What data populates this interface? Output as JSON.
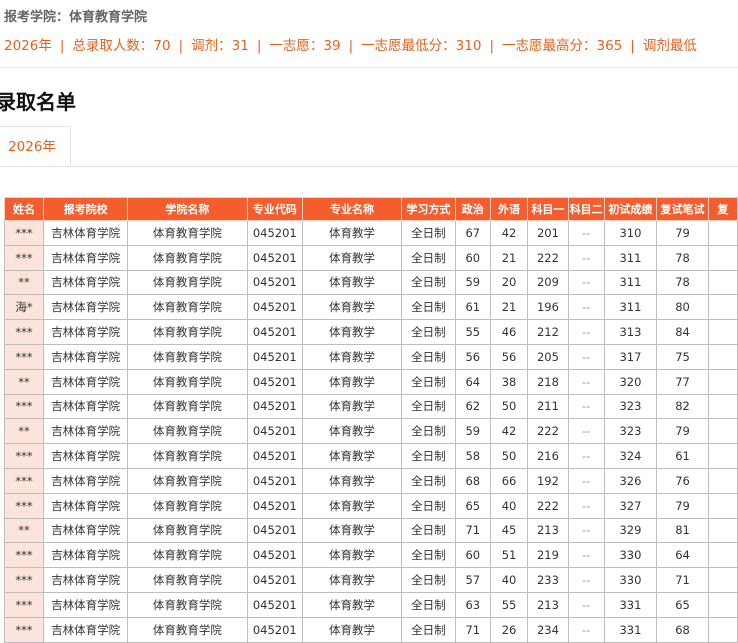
{
  "header": {
    "college_label": "报考学院：体育教育学院"
  },
  "stats": [
    "2026年",
    "总录取人数：70",
    "调剂：31",
    "一志愿：39",
    "一志愿最低分：310",
    "一志愿最高分：365",
    "调剂最低"
  ],
  "section_title": "录取名单",
  "tabs": [
    {
      "label": "2026年",
      "active": true
    }
  ],
  "table": {
    "columns": [
      "姓名",
      "报考院校",
      "学院名称",
      "专业代码",
      "专业名称",
      "学习方式",
      "政治",
      "外语",
      "科目一",
      "科目二",
      "初试成绩",
      "复试笔试",
      "复"
    ],
    "rows": [
      [
        "***",
        "吉林体育学院",
        "体育教育学院",
        "045201",
        "体育教学",
        "全日制",
        "67",
        "42",
        "201",
        "--",
        "310",
        "79",
        ""
      ],
      [
        "***",
        "吉林体育学院",
        "体育教育学院",
        "045201",
        "体育教学",
        "全日制",
        "60",
        "21",
        "222",
        "--",
        "311",
        "78",
        ""
      ],
      [
        "**",
        "吉林体育学院",
        "体育教育学院",
        "045201",
        "体育教学",
        "全日制",
        "59",
        "20",
        "209",
        "--",
        "311",
        "78",
        ""
      ],
      [
        "海*",
        "吉林体育学院",
        "体育教育学院",
        "045201",
        "体育教学",
        "全日制",
        "61",
        "21",
        "196",
        "--",
        "311",
        "80",
        ""
      ],
      [
        "***",
        "吉林体育学院",
        "体育教育学院",
        "045201",
        "体育教学",
        "全日制",
        "55",
        "46",
        "212",
        "--",
        "313",
        "84",
        ""
      ],
      [
        "***",
        "吉林体育学院",
        "体育教育学院",
        "045201",
        "体育教学",
        "全日制",
        "56",
        "56",
        "205",
        "--",
        "317",
        "75",
        ""
      ],
      [
        "**",
        "吉林体育学院",
        "体育教育学院",
        "045201",
        "体育教学",
        "全日制",
        "64",
        "38",
        "218",
        "--",
        "320",
        "77",
        ""
      ],
      [
        "***",
        "吉林体育学院",
        "体育教育学院",
        "045201",
        "体育教学",
        "全日制",
        "62",
        "50",
        "211",
        "--",
        "323",
        "82",
        ""
      ],
      [
        "**",
        "吉林体育学院",
        "体育教育学院",
        "045201",
        "体育教学",
        "全日制",
        "59",
        "42",
        "222",
        "--",
        "323",
        "79",
        ""
      ],
      [
        "***",
        "吉林体育学院",
        "体育教育学院",
        "045201",
        "体育教学",
        "全日制",
        "58",
        "50",
        "216",
        "--",
        "324",
        "61",
        ""
      ],
      [
        "***",
        "吉林体育学院",
        "体育教育学院",
        "045201",
        "体育教学",
        "全日制",
        "68",
        "66",
        "192",
        "--",
        "326",
        "76",
        ""
      ],
      [
        "***",
        "吉林体育学院",
        "体育教育学院",
        "045201",
        "体育教学",
        "全日制",
        "65",
        "40",
        "222",
        "--",
        "327",
        "79",
        ""
      ],
      [
        "**",
        "吉林体育学院",
        "体育教育学院",
        "045201",
        "体育教学",
        "全日制",
        "71",
        "45",
        "213",
        "--",
        "329",
        "81",
        ""
      ],
      [
        "***",
        "吉林体育学院",
        "体育教育学院",
        "045201",
        "体育教学",
        "全日制",
        "60",
        "51",
        "219",
        "--",
        "330",
        "64",
        ""
      ],
      [
        "***",
        "吉林体育学院",
        "体育教育学院",
        "045201",
        "体育教学",
        "全日制",
        "57",
        "40",
        "233",
        "--",
        "330",
        "71",
        ""
      ],
      [
        "***",
        "吉林体育学院",
        "体育教育学院",
        "045201",
        "体育教学",
        "全日制",
        "63",
        "55",
        "213",
        "--",
        "331",
        "65",
        ""
      ],
      [
        "***",
        "吉林体育学院",
        "体育教育学院",
        "045201",
        "体育教学",
        "全日制",
        "71",
        "26",
        "234",
        "--",
        "331",
        "68",
        ""
      ]
    ]
  },
  "colors": {
    "accent": "#e8601c",
    "header_bg": "#f45d2e",
    "name_cell_bg": "#fce4dc"
  }
}
